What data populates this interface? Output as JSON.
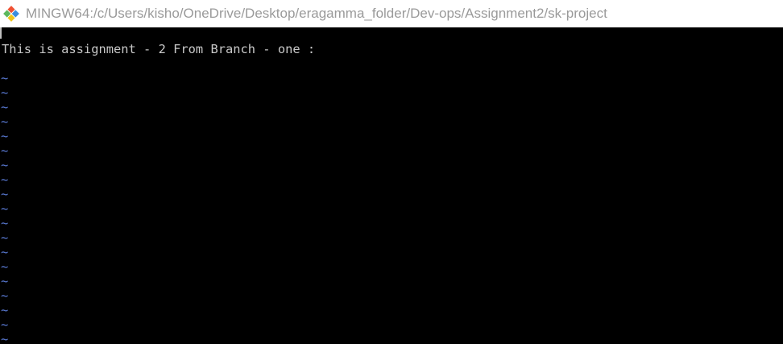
{
  "window": {
    "title": "MINGW64:/c/Users/kisho/OneDrive/Desktop/eragamma_folder/Dev-ops/Assignment2/sk-project",
    "icon": "git-bash-icon"
  },
  "colors": {
    "title_text": "#9a9a9a",
    "terminal_bg": "#000000",
    "terminal_text": "#c8c8c8",
    "tilde": "#5a7bd6",
    "icon_orange": "#f05133",
    "icon_green": "#5cb85c",
    "icon_blue": "#3c8dde",
    "icon_yellow": "#f0c419"
  },
  "editor": {
    "line1": "This is assignment - 2 From Branch - one :",
    "empty_marker": "~",
    "empty_line_count": 19
  }
}
